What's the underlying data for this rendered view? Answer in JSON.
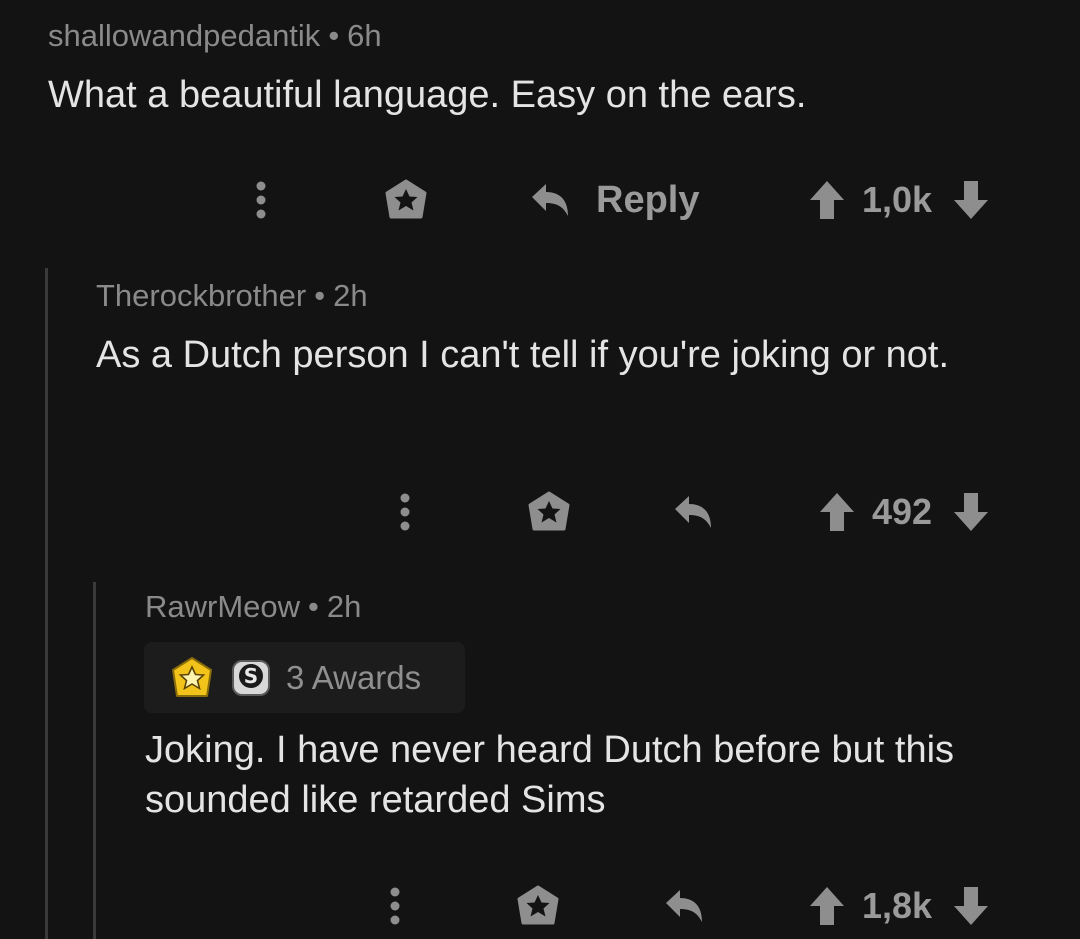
{
  "comments": [
    {
      "author": "shallowandpedantik",
      "separator": "•",
      "age": "6h",
      "text": "What a beautiful language. Easy on the ears.",
      "reply_label": "Reply",
      "score": "1,0k"
    },
    {
      "author": "Therockbrother",
      "separator": "•",
      "age": "2h",
      "text": "As a Dutch person I can't tell if you're joking or not.",
      "score": "492"
    },
    {
      "author": "RawrMeow",
      "separator": "•",
      "age": "2h",
      "awards_label": "3 Awards",
      "text": "Joking. I have never heard Dutch before but this sounded like retarded Sims",
      "score": "1,8k"
    }
  ],
  "icons": {
    "more": "more-vertical-icon",
    "award": "award-icon",
    "reply": "reply-arrow-icon",
    "upvote": "upvote-arrow-icon",
    "downvote": "downvote-arrow-icon",
    "gold_award": "gold-star-award-icon",
    "silver_award": "silver-award-icon"
  },
  "colors": {
    "background": "#131313",
    "text": "#e4e4e4",
    "muted": "#8a8a8a",
    "thread_line": "#3a3a3a",
    "gold": "#f2c31b"
  }
}
